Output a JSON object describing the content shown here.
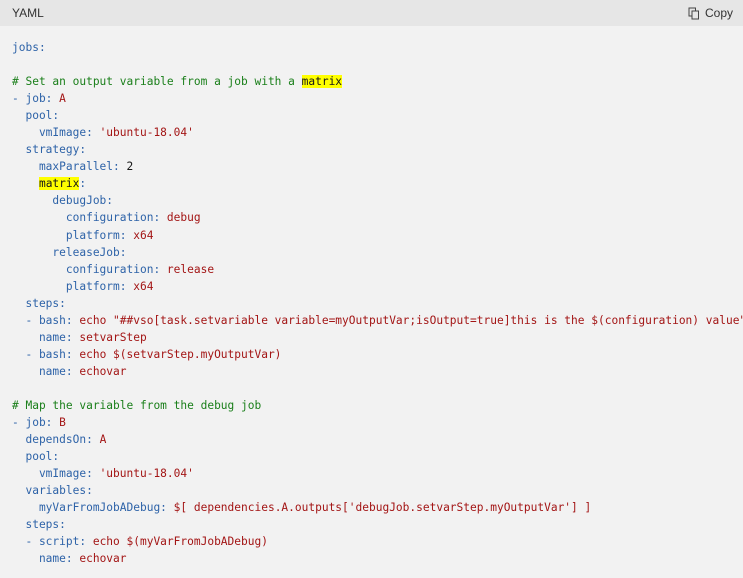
{
  "header": {
    "language": "YAML",
    "copy_label": "Copy",
    "copy_icon": "copy-icon"
  },
  "highlight_term": "matrix",
  "code_lines": [
    [
      [
        "k",
        "jobs:"
      ]
    ],
    [],
    [
      [
        "c",
        "# Set an output variable from a job with a "
      ],
      [
        "hl",
        "matrix"
      ]
    ],
    [
      [
        "k",
        "- job: "
      ],
      [
        "v",
        "A"
      ]
    ],
    [
      [
        "k",
        "  pool:"
      ]
    ],
    [
      [
        "k",
        "    vmImage: "
      ],
      [
        "v",
        "'ubuntu-18.04'"
      ]
    ],
    [
      [
        "k",
        "  strategy:"
      ]
    ],
    [
      [
        "k",
        "    maxParallel: "
      ],
      [
        "n",
        "2"
      ]
    ],
    [
      [
        "k",
        "    "
      ],
      [
        "hl",
        "matrix"
      ],
      [
        "k",
        ":"
      ]
    ],
    [
      [
        "k",
        "      debugJob:"
      ]
    ],
    [
      [
        "k",
        "        configuration: "
      ],
      [
        "v",
        "debug"
      ]
    ],
    [
      [
        "k",
        "        platform: "
      ],
      [
        "v",
        "x64"
      ]
    ],
    [
      [
        "k",
        "      releaseJob:"
      ]
    ],
    [
      [
        "k",
        "        configuration: "
      ],
      [
        "v",
        "release"
      ]
    ],
    [
      [
        "k",
        "        platform: "
      ],
      [
        "v",
        "x64"
      ]
    ],
    [
      [
        "k",
        "  steps:"
      ]
    ],
    [
      [
        "k",
        "  - bash: "
      ],
      [
        "v",
        "echo \"##vso[task.setvariable variable=myOutputVar;isOutput=true]this is the $(configuration) value\""
      ]
    ],
    [
      [
        "k",
        "    name: "
      ],
      [
        "v",
        "setvarStep"
      ]
    ],
    [
      [
        "k",
        "  - bash: "
      ],
      [
        "v",
        "echo $(setvarStep.myOutputVar)"
      ]
    ],
    [
      [
        "k",
        "    name: "
      ],
      [
        "v",
        "echovar"
      ]
    ],
    [],
    [
      [
        "c",
        "# Map the variable from the debug job"
      ]
    ],
    [
      [
        "k",
        "- job: "
      ],
      [
        "v",
        "B"
      ]
    ],
    [
      [
        "k",
        "  dependsOn: "
      ],
      [
        "v",
        "A"
      ]
    ],
    [
      [
        "k",
        "  pool:"
      ]
    ],
    [
      [
        "k",
        "    vmImage: "
      ],
      [
        "v",
        "'ubuntu-18.04'"
      ]
    ],
    [
      [
        "k",
        "  variables:"
      ]
    ],
    [
      [
        "k",
        "    myVarFromJobADebug: "
      ],
      [
        "v",
        "$[ dependencies.A.outputs['debugJob.setvarStep.myOutputVar'] ]"
      ]
    ],
    [
      [
        "k",
        "  steps:"
      ]
    ],
    [
      [
        "k",
        "  - script: "
      ],
      [
        "v",
        "echo $(myVarFromJobADebug)"
      ]
    ],
    [
      [
        "k",
        "    name: "
      ],
      [
        "v",
        "echovar"
      ]
    ]
  ]
}
